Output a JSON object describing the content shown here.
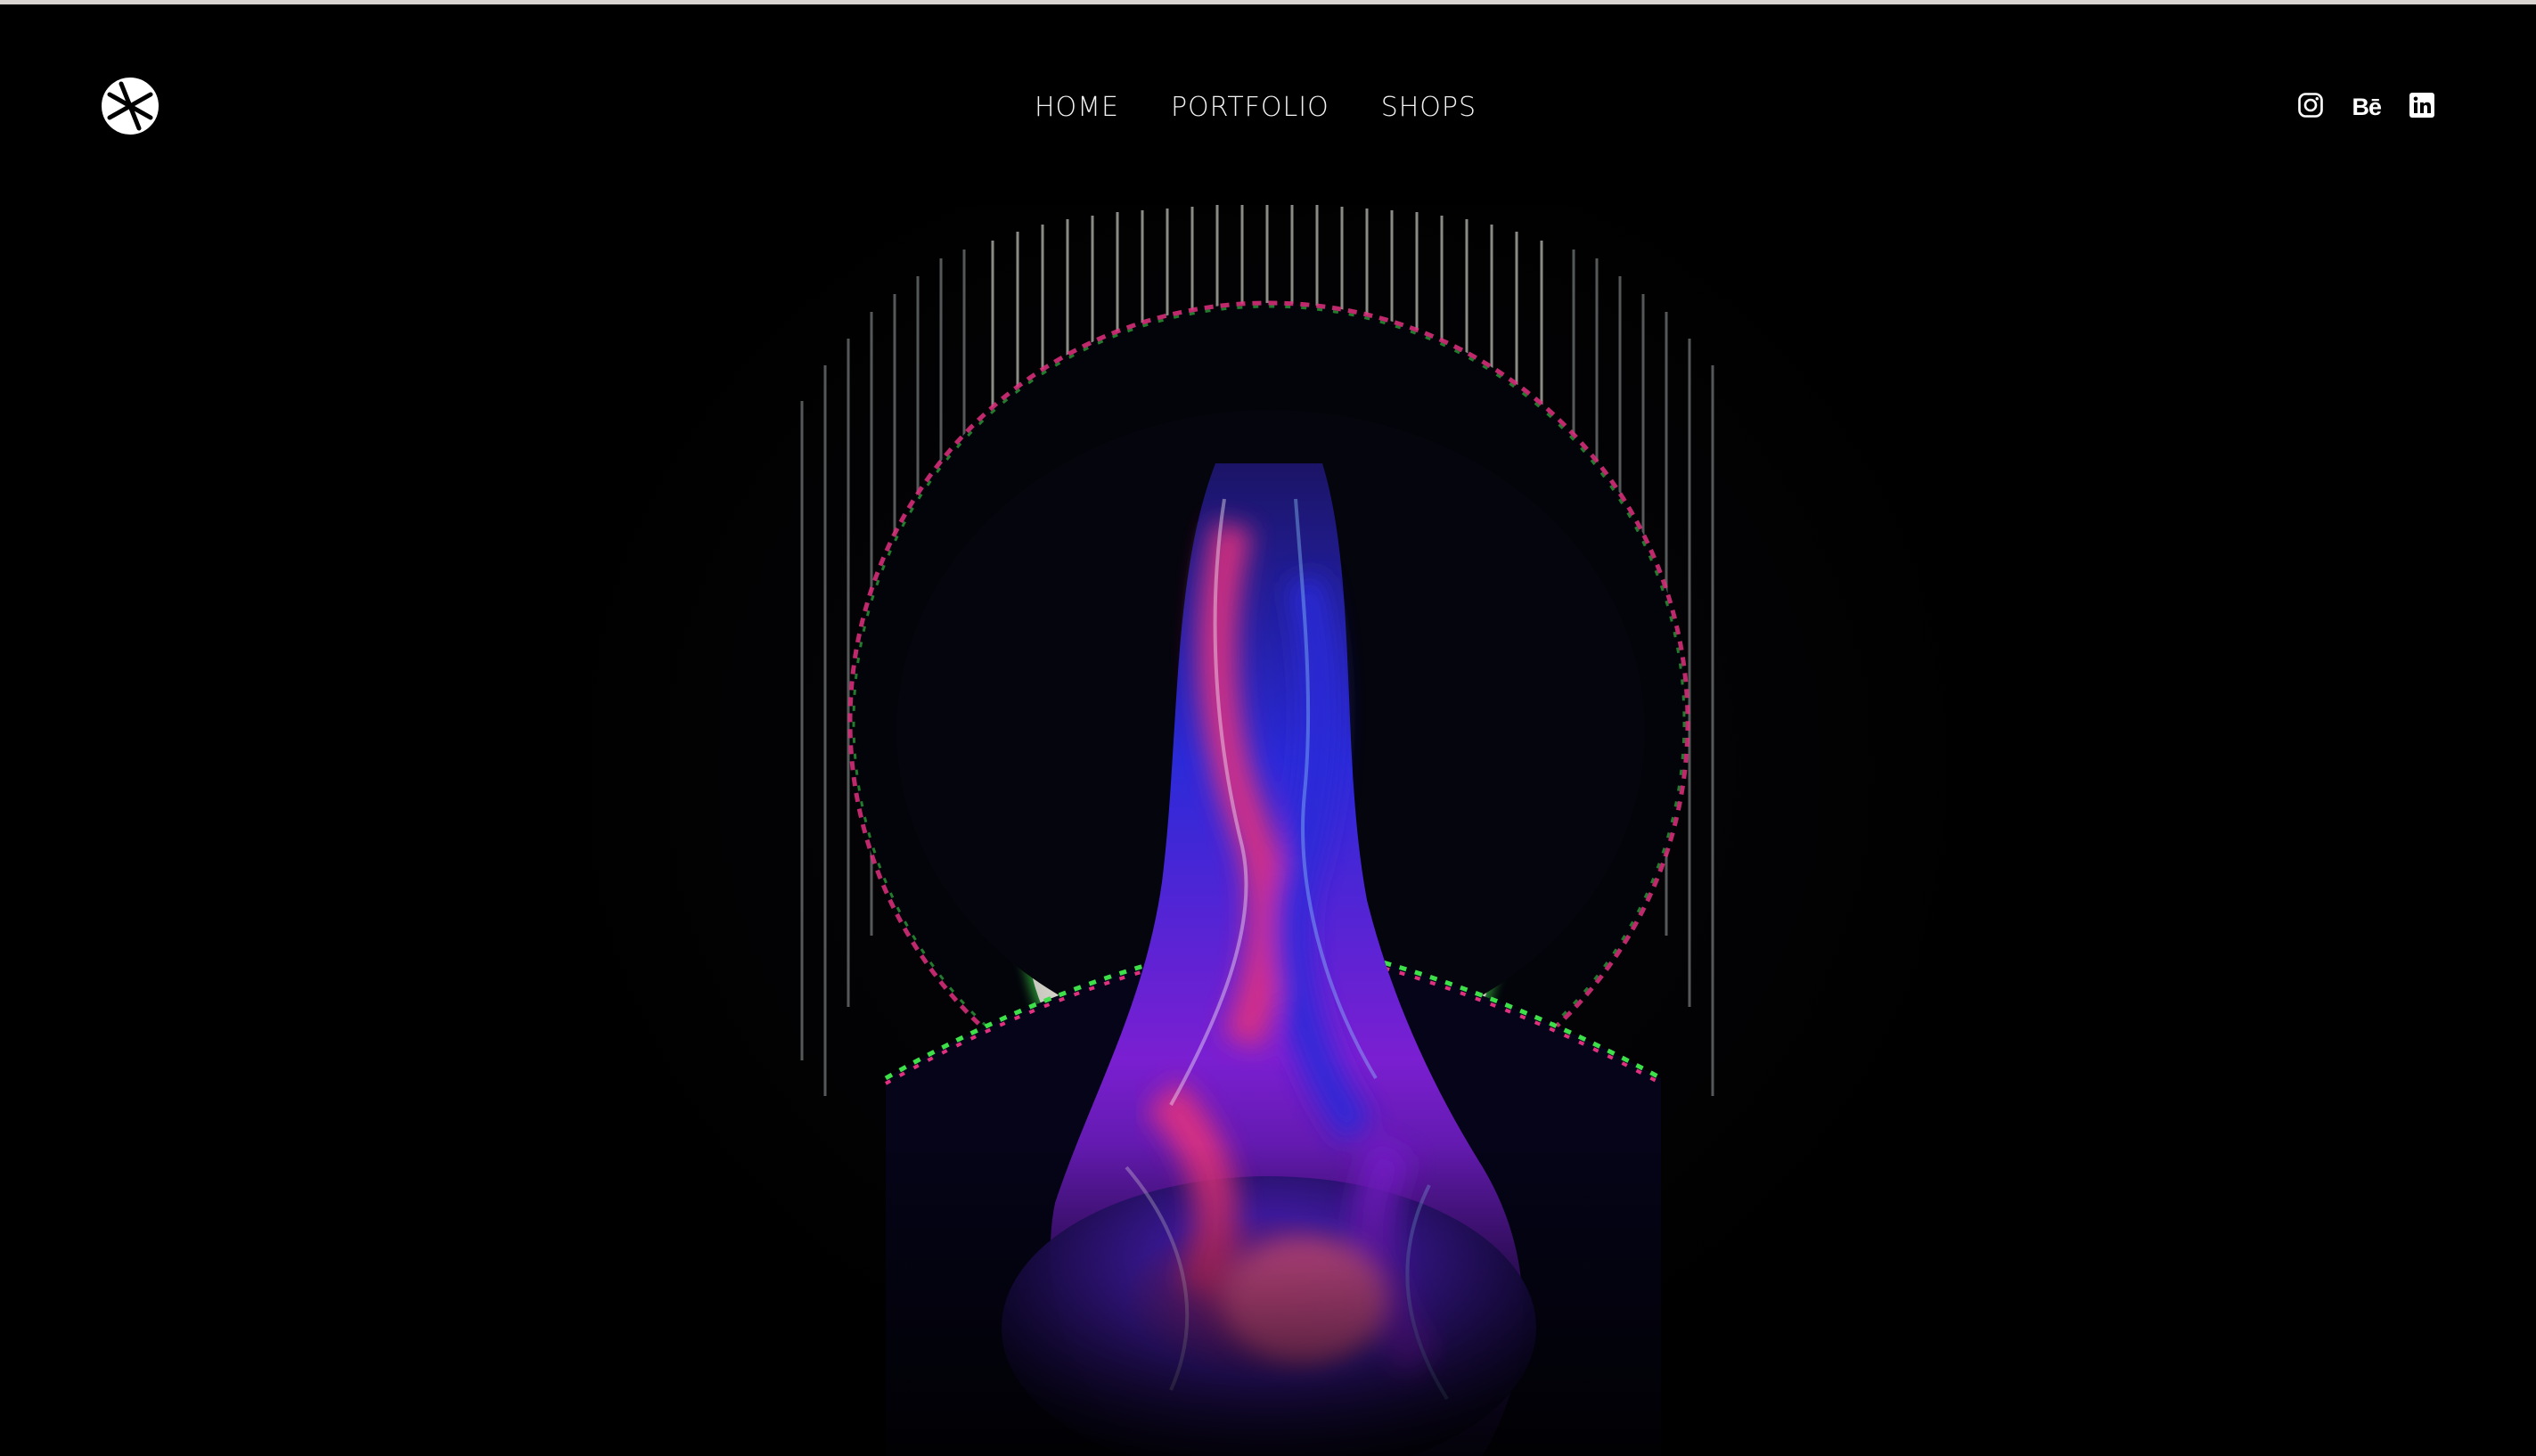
{
  "header": {
    "logo_icon": "brand-mark-icon",
    "nav": {
      "home": "HOME",
      "portfolio": "PORTFOLIO",
      "shops": "SHOPS"
    },
    "social": {
      "instagram_icon": "instagram-icon",
      "behance_label": "Bē",
      "linkedin_icon": "linkedin-icon"
    }
  },
  "hero": {
    "artwork": "hero-artwork-image"
  },
  "colors": {
    "background": "#000000",
    "nav_text": "#f2f2f2",
    "accent_magenta": "#e0307f",
    "accent_blue": "#2a2bd8",
    "accent_violet": "#7a1fd1",
    "accent_green": "#3ee04a",
    "glow_white": "#f2f2ec"
  }
}
